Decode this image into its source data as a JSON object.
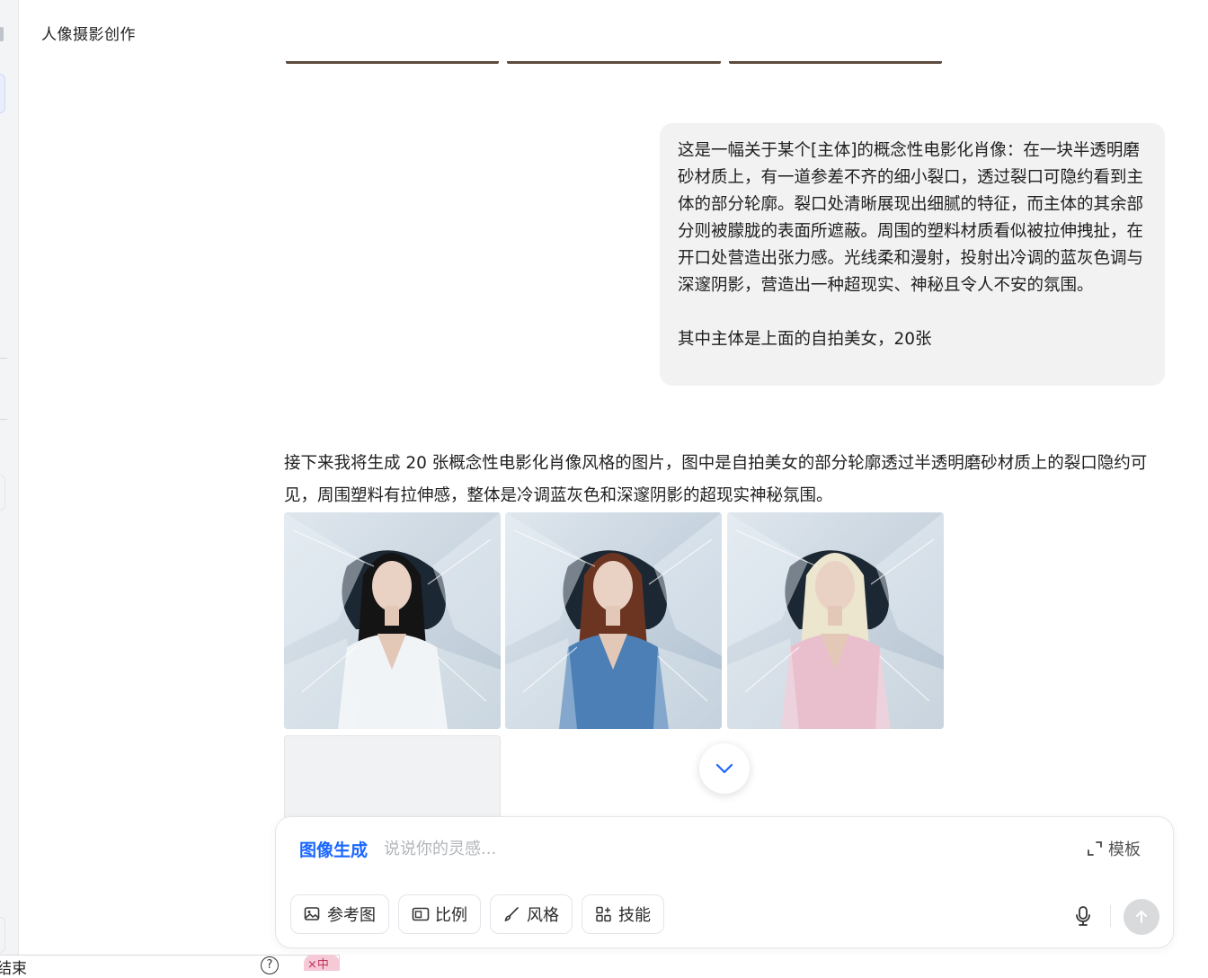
{
  "header": {
    "title": "人像摄影创作"
  },
  "user_message": {
    "paragraph1": "这是一幅关于某个[主体]的概念性电影化肖像：在一块半透明磨砂材质上，有一道参差不齐的细小裂口，透过裂口可隐约看到主体的部分轮廓。裂口处清晰展现出细腻的特征，而主体的其余部分则被朦胧的表面所遮蔽。周围的塑料材质看似被拉伸拽扯，在开口处营造出张力感。光线柔和漫射，投射出冷调的蓝灰色调与深邃阴影，营造出一种超现实、神秘且令人不安的氛围。",
    "paragraph2": "其中主体是上面的自拍美女，20张"
  },
  "assistant_message": {
    "text": "接下来我将生成 20 张概念性电影化肖像风格的图片，图中是自拍美女的部分轮廓透过半透明磨砂材质上的裂口隐约可见，周围塑料有拉伸感，整体是冷调蓝灰色和深邃阴影的超现实神秘氛围。",
    "images": [
      {
        "alt": "black-hair-white-robe-portrait",
        "robe_color": "#f1f4f7",
        "hair_color": "#141414",
        "bg": "#b7c6d3"
      },
      {
        "alt": "red-curly-hair-blue-robe-portrait",
        "robe_color": "#4b7fb5",
        "hair_color": "#6b3521",
        "bg": "#aebfcf"
      },
      {
        "alt": "blonde-hair-pink-robe-portrait",
        "robe_color": "#e9bfcd",
        "hair_color": "#ece6cf",
        "bg": "#b3c2d0"
      }
    ]
  },
  "composer": {
    "mode_label": "图像生成",
    "placeholder": "说说你的灵感...",
    "template_label": "模板",
    "chips": {
      "reference": "参考图",
      "ratio": "比例",
      "style": "风格",
      "skills": "技能"
    }
  },
  "bottom_bar": {
    "text": "结束",
    "help": "?",
    "tag": "×中"
  },
  "colors": {
    "accent": "#1a66ff",
    "bubble_bg": "#f2f2f3",
    "send_disabled": "#d9dadc"
  }
}
